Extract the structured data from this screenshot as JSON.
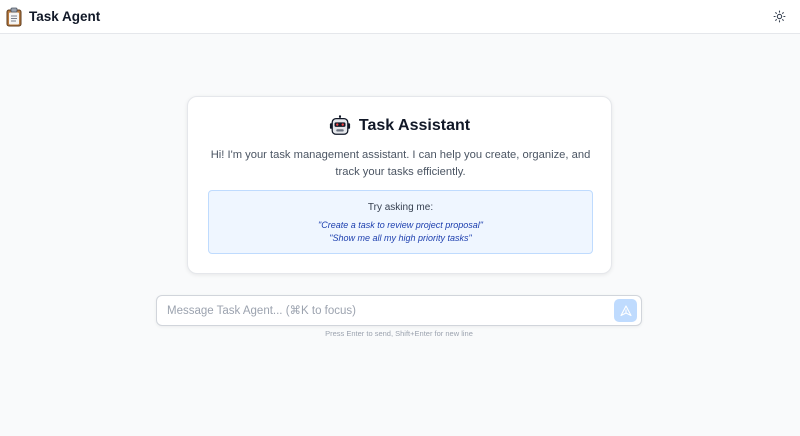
{
  "app": {
    "title": "Task Agent",
    "brand_icon": "clipboard-icon",
    "theme_icon": "sun-icon"
  },
  "welcome": {
    "icon": "robot-icon",
    "title": "Task Assistant",
    "description": "Hi! I'm your task management assistant. I can help you create, organize, and track your tasks efficiently.",
    "suggestions_heading": "Try asking me:",
    "suggestions": [
      "\"Create a task to review project proposal\"",
      "\"Show me all my high priority tasks\""
    ]
  },
  "composer": {
    "placeholder": "Message Task Agent... (⌘K to focus)",
    "value": "",
    "send_icon": "send-icon",
    "hint": "Press Enter to send, Shift+Enter for new line"
  },
  "colors": {
    "accent": "#2563eb",
    "suggest_bg": "#eff6ff",
    "suggest_text": "#1e40af",
    "send_button_bg": "#bfdbfe"
  }
}
